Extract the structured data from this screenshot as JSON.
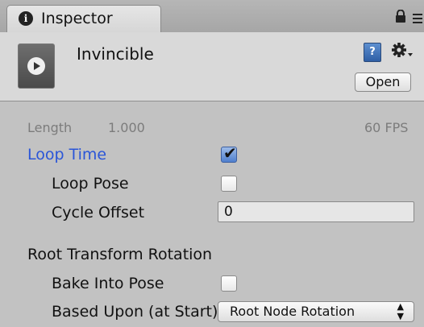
{
  "tab": {
    "title": "Inspector"
  },
  "header": {
    "asset_name": "Invincible",
    "open_label": "Open",
    "help_glyph": "?"
  },
  "info": {
    "length_label": "Length",
    "length_value": "1.000",
    "fps": "60 FPS"
  },
  "settings": {
    "loop_time": {
      "label": "Loop Time",
      "checked": true
    },
    "loop_pose": {
      "label": "Loop Pose",
      "checked": false
    },
    "cycle_offset": {
      "label": "Cycle Offset",
      "value": "0"
    },
    "root_rotation": {
      "heading": "Root Transform Rotation",
      "bake_into_pose": {
        "label": "Bake Into Pose",
        "checked": false
      },
      "based_upon": {
        "label": "Based Upon (at Start)",
        "selected": "Root Node Rotation"
      }
    }
  },
  "colors": {
    "accent_blue": "#2a55d8",
    "panel": "#c2c2c2",
    "header": "#d9d9d9"
  },
  "icons": [
    "info-icon",
    "lock-icon",
    "menu-icon",
    "animation-clip-icon",
    "help-book-icon",
    "gear-icon",
    "checkmark-icon",
    "select-arrows-icon"
  ]
}
